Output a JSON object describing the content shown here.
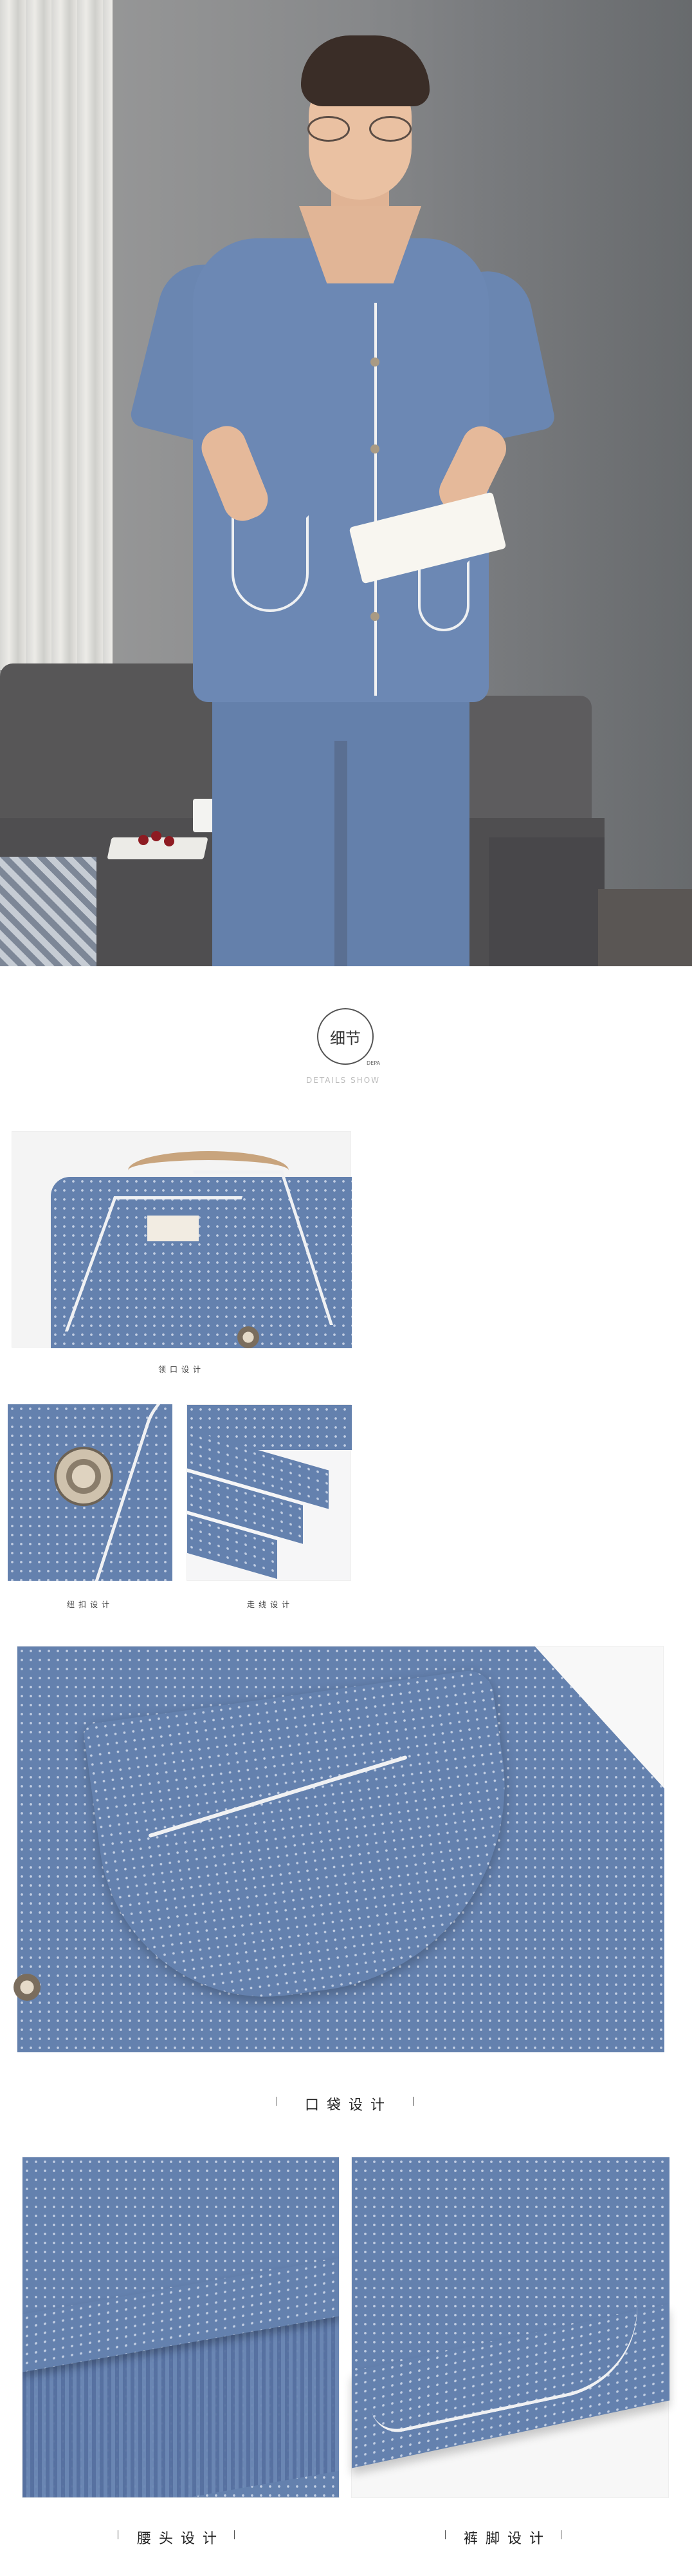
{
  "details_header": {
    "badge_label": "细节",
    "badge_sub": "DEPA",
    "subtitle_en": "DETAILS SHOW"
  },
  "captions": {
    "collar": "领口设计",
    "button": "纽扣设计",
    "stitch": "走线设计",
    "pocket": "口袋设计",
    "waist": "腰头设计",
    "cuff": "裤脚设计"
  },
  "colors": {
    "fabric": "#6481ae",
    "piping": "#f0f1f3",
    "background": "#ffffff"
  }
}
